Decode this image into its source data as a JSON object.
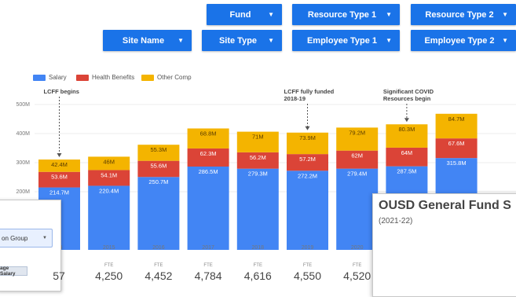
{
  "filters": [
    {
      "id": "fund",
      "label": "Fund"
    },
    {
      "id": "resource-type-1",
      "label": "Resource Type 1"
    },
    {
      "id": "resource-type-2",
      "label": "Resource Type 2"
    },
    {
      "id": "site-name",
      "label": "Site Name"
    },
    {
      "id": "site-type",
      "label": "Site Type"
    },
    {
      "id": "employee-type-1",
      "label": "Employee Type 1"
    },
    {
      "id": "employee-type-2",
      "label": "Employee Type 2"
    }
  ],
  "chart_data": {
    "type": "bar",
    "stacked": true,
    "y_ticks": [
      "500M",
      "400M",
      "300M",
      "200M"
    ],
    "ylim": [
      0,
      500
    ],
    "categories": [
      "2014",
      "2015",
      "2016",
      "2017",
      "2018",
      "2019",
      "2020",
      "2021",
      "2022"
    ],
    "x_tick_labels": [
      "14",
      "2015",
      "2016",
      "2017",
      "2018",
      "2019",
      "2020",
      "",
      ""
    ],
    "series": [
      {
        "name": "Salary",
        "color": "#4285f4",
        "values": [
          214.7,
          220.4,
          250.7,
          286.5,
          279.3,
          272.2,
          279.4,
          287.5,
          315.8
        ],
        "labels": [
          "214.7M",
          "220.4M",
          "250.7M",
          "286.5M",
          "279.3M",
          "272.2M",
          "279.4M",
          "287.5M",
          "315.8M"
        ]
      },
      {
        "name": "Health Benefits",
        "color": "#db4437",
        "values": [
          53.6,
          54.1,
          55.6,
          62.3,
          56.2,
          57.2,
          62,
          64,
          67.6
        ],
        "labels": [
          "53.6M",
          "54.1M",
          "55.6M",
          "62.3M",
          "56.2M",
          "57.2M",
          "62M",
          "64M",
          "67.6M"
        ]
      },
      {
        "name": "Other Comp",
        "color": "#f4b400",
        "values": [
          42.4,
          46,
          55.3,
          68.8,
          71,
          73.9,
          79.2,
          80.3,
          84.7
        ],
        "labels": [
          "42.4M",
          "46M",
          "55.3M",
          "68.8M",
          "71M",
          "73.9M",
          "79.2M",
          "80.3M",
          "84.7M"
        ]
      }
    ],
    "annotations": [
      {
        "category": "2014",
        "lines": [
          "LCFF begins"
        ]
      },
      {
        "category": "2019",
        "lines": [
          "LCFF fully funded",
          "2018-19"
        ]
      },
      {
        "category": "2021",
        "lines": [
          "Significant COVID",
          "Resources begin"
        ]
      }
    ]
  },
  "fte": {
    "caption": "FTE",
    "values": [
      "57",
      "4,250",
      "4,452",
      "4,784",
      "4,616",
      "4,550",
      "4,520"
    ]
  },
  "left_panel": {
    "dropdown_label": "on Group",
    "chip_label": "age Salary"
  },
  "right_panel": {
    "title": "OUSD General Fund S",
    "subtitle": "(2021-22)"
  },
  "colors": {
    "accent": "#1a73e8"
  }
}
